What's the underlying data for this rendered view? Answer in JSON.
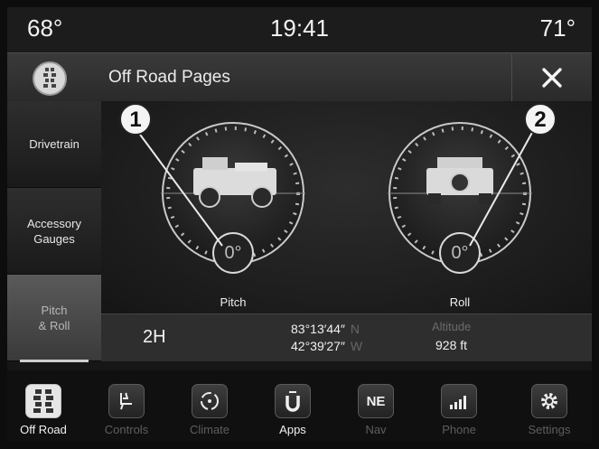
{
  "status": {
    "temp_left": "68°",
    "time": "19:41",
    "temp_right": "71°"
  },
  "header": {
    "title": "Off Road Pages",
    "close_icon": "close-icon",
    "tire_icon": "tire-tread-icon"
  },
  "sidebar": {
    "items": [
      {
        "label": "Drivetrain"
      },
      {
        "label": "Accessory\nGauges"
      },
      {
        "label": "Pitch\n& Roll",
        "selected": true
      }
    ]
  },
  "gauges": {
    "pitch": {
      "callout": "1",
      "value": "0°",
      "label": "Pitch"
    },
    "roll": {
      "callout": "2",
      "value": "0°",
      "label": "Roll"
    }
  },
  "info": {
    "drive_mode": "2H",
    "latitude": "83°13′44″",
    "lat_dir": "N",
    "longitude": "42°39′27″",
    "lon_dir": "W",
    "altitude_label": "Altitude",
    "altitude": "928 ft"
  },
  "nav": {
    "items": [
      {
        "label": "Off Road",
        "icon": "tire-icon",
        "active": true
      },
      {
        "label": "Controls",
        "icon": "seat-heat-icon"
      },
      {
        "label": "Climate",
        "icon": "climate-fan-icon"
      },
      {
        "label": "Apps",
        "icon": "uconnect-icon"
      },
      {
        "label": "Nav",
        "icon": "compass-icon",
        "text": "NE"
      },
      {
        "label": "Phone",
        "icon": "signal-bars-icon"
      },
      {
        "label": "Settings",
        "icon": "gear-icon"
      }
    ]
  },
  "colors": {
    "accent": "#ffffff",
    "background": "#161616",
    "inactive_text": "#5e5e5e"
  }
}
